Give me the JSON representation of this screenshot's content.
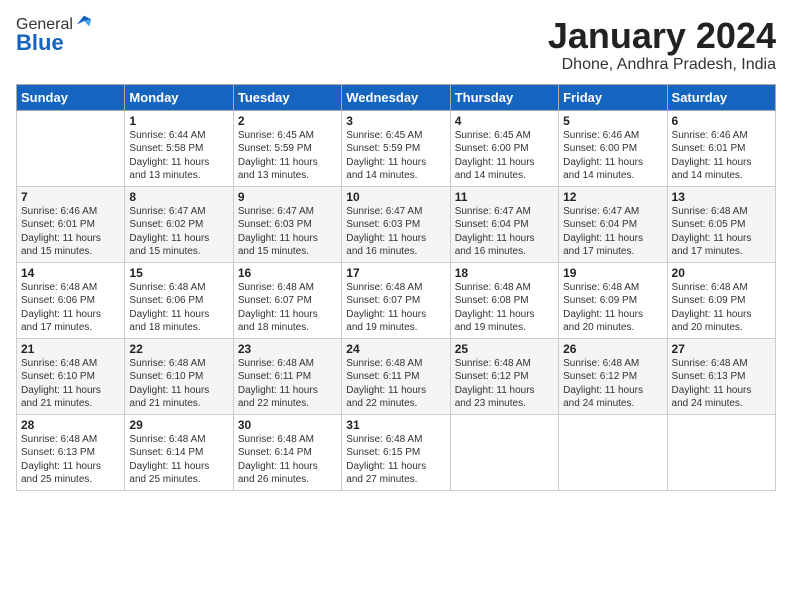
{
  "header": {
    "logo_general": "General",
    "logo_blue": "Blue",
    "month_title": "January 2024",
    "location": "Dhone, Andhra Pradesh, India"
  },
  "days_of_week": [
    "Sunday",
    "Monday",
    "Tuesday",
    "Wednesday",
    "Thursday",
    "Friday",
    "Saturday"
  ],
  "weeks": [
    [
      {
        "day": "",
        "info": ""
      },
      {
        "day": "1",
        "info": "Sunrise: 6:44 AM\nSunset: 5:58 PM\nDaylight: 11 hours\nand 13 minutes."
      },
      {
        "day": "2",
        "info": "Sunrise: 6:45 AM\nSunset: 5:59 PM\nDaylight: 11 hours\nand 13 minutes."
      },
      {
        "day": "3",
        "info": "Sunrise: 6:45 AM\nSunset: 5:59 PM\nDaylight: 11 hours\nand 14 minutes."
      },
      {
        "day": "4",
        "info": "Sunrise: 6:45 AM\nSunset: 6:00 PM\nDaylight: 11 hours\nand 14 minutes."
      },
      {
        "day": "5",
        "info": "Sunrise: 6:46 AM\nSunset: 6:00 PM\nDaylight: 11 hours\nand 14 minutes."
      },
      {
        "day": "6",
        "info": "Sunrise: 6:46 AM\nSunset: 6:01 PM\nDaylight: 11 hours\nand 14 minutes."
      }
    ],
    [
      {
        "day": "7",
        "info": "Sunrise: 6:46 AM\nSunset: 6:01 PM\nDaylight: 11 hours\nand 15 minutes."
      },
      {
        "day": "8",
        "info": "Sunrise: 6:47 AM\nSunset: 6:02 PM\nDaylight: 11 hours\nand 15 minutes."
      },
      {
        "day": "9",
        "info": "Sunrise: 6:47 AM\nSunset: 6:03 PM\nDaylight: 11 hours\nand 15 minutes."
      },
      {
        "day": "10",
        "info": "Sunrise: 6:47 AM\nSunset: 6:03 PM\nDaylight: 11 hours\nand 16 minutes."
      },
      {
        "day": "11",
        "info": "Sunrise: 6:47 AM\nSunset: 6:04 PM\nDaylight: 11 hours\nand 16 minutes."
      },
      {
        "day": "12",
        "info": "Sunrise: 6:47 AM\nSunset: 6:04 PM\nDaylight: 11 hours\nand 17 minutes."
      },
      {
        "day": "13",
        "info": "Sunrise: 6:48 AM\nSunset: 6:05 PM\nDaylight: 11 hours\nand 17 minutes."
      }
    ],
    [
      {
        "day": "14",
        "info": "Sunrise: 6:48 AM\nSunset: 6:06 PM\nDaylight: 11 hours\nand 17 minutes."
      },
      {
        "day": "15",
        "info": "Sunrise: 6:48 AM\nSunset: 6:06 PM\nDaylight: 11 hours\nand 18 minutes."
      },
      {
        "day": "16",
        "info": "Sunrise: 6:48 AM\nSunset: 6:07 PM\nDaylight: 11 hours\nand 18 minutes."
      },
      {
        "day": "17",
        "info": "Sunrise: 6:48 AM\nSunset: 6:07 PM\nDaylight: 11 hours\nand 19 minutes."
      },
      {
        "day": "18",
        "info": "Sunrise: 6:48 AM\nSunset: 6:08 PM\nDaylight: 11 hours\nand 19 minutes."
      },
      {
        "day": "19",
        "info": "Sunrise: 6:48 AM\nSunset: 6:09 PM\nDaylight: 11 hours\nand 20 minutes."
      },
      {
        "day": "20",
        "info": "Sunrise: 6:48 AM\nSunset: 6:09 PM\nDaylight: 11 hours\nand 20 minutes."
      }
    ],
    [
      {
        "day": "21",
        "info": "Sunrise: 6:48 AM\nSunset: 6:10 PM\nDaylight: 11 hours\nand 21 minutes."
      },
      {
        "day": "22",
        "info": "Sunrise: 6:48 AM\nSunset: 6:10 PM\nDaylight: 11 hours\nand 21 minutes."
      },
      {
        "day": "23",
        "info": "Sunrise: 6:48 AM\nSunset: 6:11 PM\nDaylight: 11 hours\nand 22 minutes."
      },
      {
        "day": "24",
        "info": "Sunrise: 6:48 AM\nSunset: 6:11 PM\nDaylight: 11 hours\nand 22 minutes."
      },
      {
        "day": "25",
        "info": "Sunrise: 6:48 AM\nSunset: 6:12 PM\nDaylight: 11 hours\nand 23 minutes."
      },
      {
        "day": "26",
        "info": "Sunrise: 6:48 AM\nSunset: 6:12 PM\nDaylight: 11 hours\nand 24 minutes."
      },
      {
        "day": "27",
        "info": "Sunrise: 6:48 AM\nSunset: 6:13 PM\nDaylight: 11 hours\nand 24 minutes."
      }
    ],
    [
      {
        "day": "28",
        "info": "Sunrise: 6:48 AM\nSunset: 6:13 PM\nDaylight: 11 hours\nand 25 minutes."
      },
      {
        "day": "29",
        "info": "Sunrise: 6:48 AM\nSunset: 6:14 PM\nDaylight: 11 hours\nand 25 minutes."
      },
      {
        "day": "30",
        "info": "Sunrise: 6:48 AM\nSunset: 6:14 PM\nDaylight: 11 hours\nand 26 minutes."
      },
      {
        "day": "31",
        "info": "Sunrise: 6:48 AM\nSunset: 6:15 PM\nDaylight: 11 hours\nand 27 minutes."
      },
      {
        "day": "",
        "info": ""
      },
      {
        "day": "",
        "info": ""
      },
      {
        "day": "",
        "info": ""
      }
    ]
  ]
}
